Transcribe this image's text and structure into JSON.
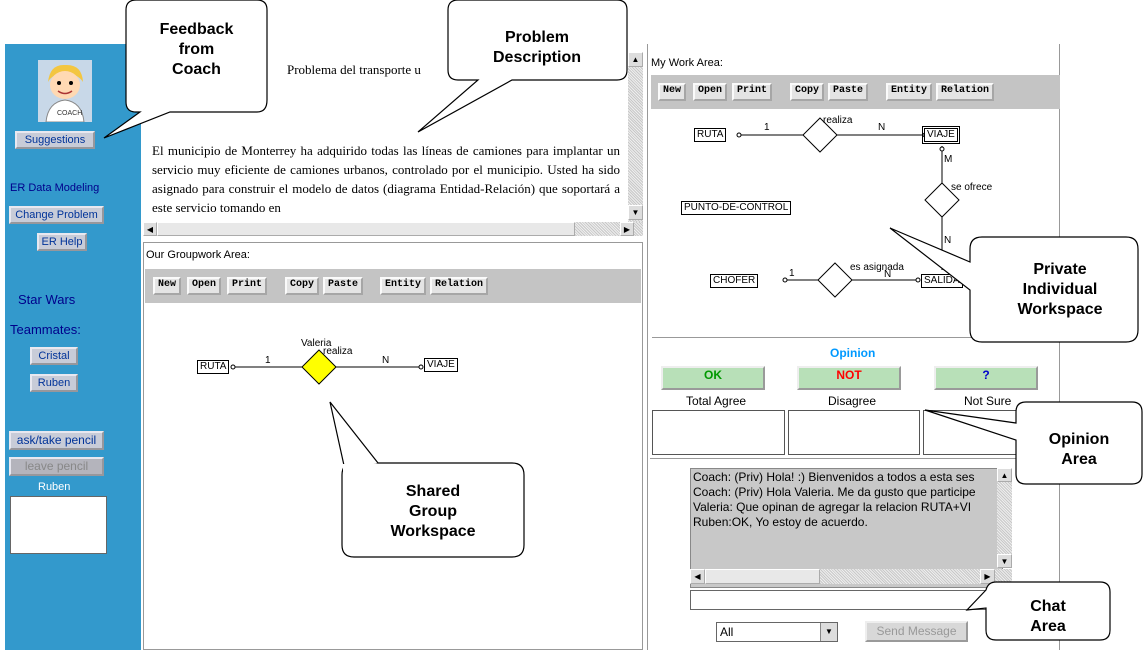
{
  "sidebar": {
    "suggestions_label": "Suggestions",
    "er_data_modeling": "ER Data Modeling",
    "change_problem_label": "Change Problem",
    "er_help_label": "ER Help",
    "group_name": "Star Wars",
    "teammates_label": "Teammates:",
    "teammates": [
      "Cristal",
      "Ruben"
    ],
    "ask_pencil_label": "ask/take pencil",
    "leave_pencil_label": "leave pencil",
    "pencil_holder": "Ruben"
  },
  "problem": {
    "title": "Problema del transporte u",
    "body": "El municipio de Monterrey ha adquirido todas las líneas de camiones para implantar un servicio muy eficiente de camiones urbanos, controlado por el municipio. Usted ha sido asignado para construir el modelo de datos (diagrama Entidad-Relación) que soportará a este servicio tomando en"
  },
  "group_area": {
    "label": "Our Groupwork Area:",
    "toolbar": [
      "New",
      "Open",
      "Print",
      "Copy",
      "Paste",
      "Entity",
      "Relation"
    ],
    "diagram": {
      "entity_left": "RUTA",
      "entity_right": "VIAJE",
      "relation": "realiza",
      "card_left": "1",
      "card_right": "N",
      "editor": "Valeria"
    }
  },
  "work_area": {
    "label": "My Work Area:",
    "toolbar": [
      "New",
      "Open",
      "Print",
      "Copy",
      "Paste",
      "Entity",
      "Relation"
    ],
    "diagram": {
      "ruta": "RUTA",
      "viaje": "VIAJE",
      "punto": "PUNTO-DE-CONTROL",
      "chofer": "CHOFER",
      "salida": "SALIDA",
      "rel_realiza": "realiza",
      "rel_ofrece": "se ofrece",
      "rel_asignada": "es asignada",
      "c1": "1",
      "cN": "N",
      "cM": "M",
      "cN2": "N",
      "c1b": "1",
      "cN3": "N"
    }
  },
  "opinion": {
    "title": "Opinion",
    "ok": "OK",
    "not": "NOT",
    "unsure": "?",
    "agree": "Total Agree",
    "disagree": "Disagree",
    "not_sure": "Not Sure",
    "colors": {
      "title": "#0099ff",
      "ok": "#009900",
      "not": "#ff0000",
      "unsure": "#0000cc",
      "btn_bg": "#b8e0b8"
    }
  },
  "chat": {
    "messages": [
      "Coach: (Priv) Hola! :) Bienvenidos a todos a esta ses",
      "Coach: (Priv) Hola Valeria. Me da gusto que participe",
      "Valeria: Que opinan de agregar la relacion RUTA+VI",
      "Ruben:OK, Yo estoy de acuerdo."
    ],
    "recipient": "All",
    "send_label": "Send Message"
  },
  "callouts": {
    "coach": [
      "Feedback",
      "from",
      "Coach"
    ],
    "problem": [
      "Problem",
      "Description"
    ],
    "private": [
      "Private",
      "Individual",
      "Workspace"
    ],
    "shared": [
      "Shared",
      "Group",
      "Workspace"
    ],
    "opinion": [
      "Opinion",
      "Area"
    ],
    "chat": [
      "Chat",
      "Area"
    ]
  }
}
